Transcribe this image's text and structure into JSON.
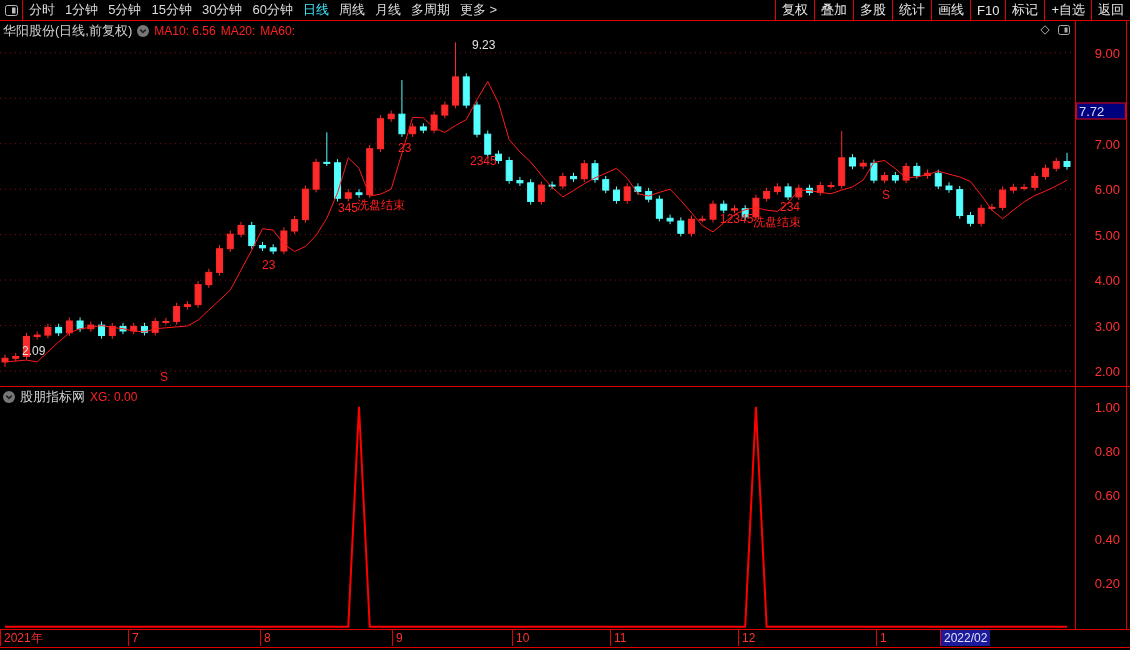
{
  "toolbar": {
    "periods": [
      {
        "label": "分时",
        "selected": false
      },
      {
        "label": "1分钟",
        "selected": false
      },
      {
        "label": "5分钟",
        "selected": false
      },
      {
        "label": "15分钟",
        "selected": false
      },
      {
        "label": "30分钟",
        "selected": false
      },
      {
        "label": "60分钟",
        "selected": false
      },
      {
        "label": "日线",
        "selected": true
      },
      {
        "label": "周线",
        "selected": false
      },
      {
        "label": "月线",
        "selected": false
      },
      {
        "label": "多周期",
        "selected": false
      },
      {
        "label": "更多 >",
        "selected": false
      }
    ],
    "buttons": [
      "复权",
      "叠加",
      "多股",
      "统计",
      "画线",
      "F10",
      "标记",
      "+自选",
      "返回"
    ]
  },
  "main_panel": {
    "title": "华阳股份(日线,前复权)",
    "indicators": [
      {
        "label": "MA10: 6.56"
      },
      {
        "label": "MA20:"
      },
      {
        "label": "MA60:"
      }
    ],
    "current_price": "7.72",
    "chart_data": {
      "type": "candlestick",
      "grid": true,
      "ylim": [
        1.67,
        9.7
      ],
      "yticks": [
        {
          "value": 9,
          "label": "9.00"
        },
        {
          "value": 7,
          "label": "7.00"
        },
        {
          "value": 6,
          "label": "6.00"
        },
        {
          "value": 5,
          "label": "5.00"
        },
        {
          "value": 4,
          "label": "4.00"
        },
        {
          "value": 3,
          "label": "3.00"
        },
        {
          "value": 2,
          "label": "2.00"
        }
      ],
      "categories": [
        null,
        null,
        null,
        null,
        null,
        null,
        null,
        null,
        null,
        null,
        null,
        null,
        null,
        null,
        null,
        null,
        null,
        null,
        null,
        null,
        null,
        null,
        null,
        null,
        null,
        null,
        null,
        null,
        null,
        null,
        null,
        null,
        null,
        null,
        null,
        null,
        null,
        null,
        null,
        null,
        null,
        null,
        null,
        null,
        null,
        null,
        null,
        null,
        null,
        null,
        null,
        null,
        null,
        null,
        null,
        null,
        null,
        null,
        null,
        null,
        null,
        null,
        null,
        null,
        null,
        null,
        null,
        null,
        null,
        null,
        null,
        null,
        null,
        null,
        null,
        null,
        null,
        null,
        null,
        null,
        null,
        null,
        null,
        null,
        null,
        null,
        null,
        null,
        null,
        null,
        null,
        null,
        null,
        null,
        null,
        null,
        null,
        null,
        null,
        null
      ],
      "ohlc": [
        [
          2.2,
          2.36,
          2.09,
          2.28
        ],
        [
          2.28,
          2.4,
          2.21,
          2.32
        ],
        [
          2.32,
          2.84,
          2.25,
          2.76
        ],
        [
          2.76,
          2.87,
          2.69,
          2.79
        ],
        [
          2.79,
          3.04,
          2.72,
          2.96
        ],
        [
          2.96,
          3.04,
          2.77,
          2.84
        ],
        [
          2.84,
          3.18,
          2.77,
          3.1
        ],
        [
          3.1,
          3.18,
          2.86,
          2.93
        ],
        [
          2.93,
          3.09,
          2.86,
          3.01
        ],
        [
          3.01,
          3.09,
          2.71,
          2.78
        ],
        [
          2.78,
          3.06,
          2.71,
          2.98
        ],
        [
          2.98,
          3.06,
          2.81,
          2.88
        ],
        [
          2.88,
          3.06,
          2.81,
          2.98
        ],
        [
          2.98,
          3.06,
          2.78,
          2.85
        ],
        [
          2.85,
          3.17,
          2.78,
          3.09
        ],
        [
          3.09,
          3.17,
          3.02,
          3.09
        ],
        [
          3.09,
          3.5,
          3.02,
          3.42
        ],
        [
          3.42,
          3.54,
          3.35,
          3.46
        ],
        [
          3.46,
          3.98,
          3.39,
          3.9
        ],
        [
          3.9,
          4.25,
          3.83,
          4.17
        ],
        [
          4.17,
          4.77,
          4.1,
          4.69
        ],
        [
          4.69,
          5.09,
          4.62,
          5.01
        ],
        [
          5.01,
          5.28,
          4.94,
          5.2
        ],
        [
          5.2,
          5.28,
          4.69,
          4.76
        ],
        [
          4.76,
          4.84,
          4.64,
          4.71
        ],
        [
          4.71,
          4.79,
          4.57,
          4.64
        ],
        [
          4.64,
          5.16,
          4.57,
          5.08
        ],
        [
          5.08,
          5.41,
          5.01,
          5.33
        ],
        [
          5.33,
          6.08,
          5.26,
          6.0
        ],
        [
          6.0,
          6.67,
          5.93,
          6.59
        ],
        [
          6.59,
          7.25,
          6.51,
          6.58
        ],
        [
          6.58,
          6.66,
          5.73,
          5.8
        ],
        [
          5.8,
          6.0,
          5.73,
          5.92
        ],
        [
          5.92,
          6.0,
          5.81,
          5.88
        ],
        [
          5.88,
          6.97,
          5.81,
          6.89
        ],
        [
          6.89,
          7.63,
          6.82,
          7.55
        ],
        [
          7.55,
          7.73,
          7.48,
          7.65
        ],
        [
          7.65,
          8.4,
          7.15,
          7.22
        ],
        [
          7.22,
          7.45,
          7.15,
          7.37
        ],
        [
          7.37,
          7.45,
          7.23,
          7.3
        ],
        [
          7.3,
          7.71,
          7.23,
          7.63
        ],
        [
          7.63,
          7.93,
          7.56,
          7.85
        ],
        [
          7.85,
          9.23,
          7.78,
          8.47
        ],
        [
          8.47,
          8.55,
          7.78,
          7.85
        ],
        [
          7.85,
          7.93,
          7.14,
          7.21
        ],
        [
          7.21,
          7.29,
          6.7,
          6.77
        ],
        [
          6.77,
          6.85,
          6.56,
          6.63
        ],
        [
          6.63,
          6.71,
          6.12,
          6.19
        ],
        [
          6.19,
          6.27,
          6.07,
          6.14
        ],
        [
          6.14,
          6.22,
          5.66,
          5.73
        ],
        [
          5.73,
          6.17,
          5.66,
          6.09
        ],
        [
          6.09,
          6.17,
          6.0,
          6.07
        ],
        [
          6.07,
          6.36,
          6.0,
          6.28
        ],
        [
          6.28,
          6.36,
          6.16,
          6.23
        ],
        [
          6.23,
          6.64,
          6.16,
          6.56
        ],
        [
          6.56,
          6.64,
          6.14,
          6.21
        ],
        [
          6.21,
          6.29,
          5.91,
          5.98
        ],
        [
          5.98,
          6.06,
          5.68,
          5.75
        ],
        [
          5.75,
          6.13,
          5.68,
          6.05
        ],
        [
          6.05,
          6.13,
          5.88,
          5.95
        ],
        [
          5.95,
          6.03,
          5.71,
          5.78
        ],
        [
          5.78,
          5.86,
          5.29,
          5.36
        ],
        [
          5.36,
          5.44,
          5.23,
          5.3
        ],
        [
          5.3,
          5.38,
          4.96,
          5.03
        ],
        [
          5.03,
          5.42,
          4.96,
          5.34
        ],
        [
          5.34,
          5.42,
          5.27,
          5.34
        ],
        [
          5.34,
          5.75,
          5.27,
          5.67
        ],
        [
          5.67,
          5.75,
          5.47,
          5.54
        ],
        [
          5.54,
          5.65,
          5.47,
          5.57
        ],
        [
          5.57,
          5.65,
          5.32,
          5.39
        ],
        [
          5.39,
          5.88,
          5.32,
          5.8
        ],
        [
          5.8,
          6.03,
          5.73,
          5.95
        ],
        [
          5.95,
          6.13,
          5.88,
          6.05
        ],
        [
          6.05,
          6.13,
          5.76,
          5.83
        ],
        [
          5.83,
          6.1,
          5.76,
          6.02
        ],
        [
          6.02,
          6.1,
          5.86,
          5.93
        ],
        [
          5.93,
          6.16,
          5.86,
          6.08
        ],
        [
          6.08,
          6.16,
          6.01,
          6.08
        ],
        [
          6.08,
          7.28,
          6.01,
          6.69
        ],
        [
          6.69,
          6.77,
          6.44,
          6.51
        ],
        [
          6.51,
          6.65,
          6.44,
          6.57
        ],
        [
          6.57,
          6.65,
          6.13,
          6.2
        ],
        [
          6.2,
          6.38,
          6.13,
          6.3
        ],
        [
          6.3,
          6.38,
          6.13,
          6.2
        ],
        [
          6.2,
          6.58,
          6.13,
          6.5
        ],
        [
          6.5,
          6.58,
          6.23,
          6.3
        ],
        [
          6.3,
          6.43,
          6.23,
          6.35
        ],
        [
          6.35,
          6.43,
          6.0,
          6.07
        ],
        [
          6.07,
          6.15,
          5.92,
          5.99
        ],
        [
          5.99,
          6.07,
          5.35,
          5.42
        ],
        [
          5.42,
          5.5,
          5.18,
          5.25
        ],
        [
          5.25,
          5.66,
          5.18,
          5.58
        ],
        [
          5.58,
          5.68,
          5.53,
          5.6
        ],
        [
          5.6,
          6.06,
          5.53,
          5.98
        ],
        [
          5.98,
          6.12,
          5.91,
          6.04
        ],
        [
          6.04,
          6.12,
          5.97,
          6.04
        ],
        [
          6.04,
          6.36,
          5.97,
          6.28
        ],
        [
          6.28,
          6.54,
          6.21,
          6.46
        ],
        [
          6.46,
          6.69,
          6.39,
          6.61
        ],
        [
          6.61,
          6.8,
          6.43,
          6.5
        ]
      ],
      "series": [
        {
          "type": "line",
          "color": "#ff1a1a",
          "values": [
            2.2,
            2.22,
            2.24,
            2.2,
            2.42,
            2.64,
            2.84,
            2.93,
            2.96,
            3.0,
            2.96,
            2.93,
            2.88,
            2.86,
            2.93,
            2.95,
            2.97,
            2.99,
            3.12,
            3.34,
            3.56,
            3.78,
            4.22,
            4.66,
            5.13,
            5.1,
            4.79,
            4.63,
            4.74,
            4.98,
            5.36,
            5.92,
            6.69,
            6.46,
            5.85,
            5.89,
            6.0,
            6.79,
            7.58,
            7.57,
            7.34,
            7.25,
            7.4,
            7.53,
            7.97,
            8.37,
            7.9,
            7.09,
            6.82,
            6.6,
            6.31,
            6.04,
            5.83,
            5.97,
            6.12,
            6.25,
            6.35,
            6.46,
            6.24,
            5.9,
            5.85,
            5.93,
            6.0,
            5.75,
            5.48,
            5.2,
            5.06,
            5.26,
            5.44,
            5.55,
            5.59,
            5.54,
            5.51,
            5.7,
            5.98,
            5.97,
            5.93,
            5.9,
            5.98,
            6.05,
            6.2,
            6.59,
            6.63,
            6.45,
            6.25,
            6.27,
            6.32,
            6.4,
            6.33,
            6.27,
            6.17,
            5.87,
            5.54,
            5.35,
            5.54,
            5.72,
            5.86,
            5.96,
            6.07,
            6.2
          ]
        }
      ]
    },
    "annotations": [
      {
        "text": "9.23"
      },
      {
        "text": "2.09"
      },
      {
        "text": "洗盘结束"
      },
      {
        "text": "洗盘结束"
      },
      {
        "text": "S"
      },
      {
        "text": "S"
      },
      {
        "text": "23"
      },
      {
        "text": "345"
      },
      {
        "text": "2345"
      },
      {
        "text": "23"
      },
      {
        "text": "12345"
      },
      {
        "text": "234"
      }
    ]
  },
  "indicator_panel": {
    "title": "股朋指标网",
    "reading": "XG: 0.00",
    "chart_data": {
      "type": "line",
      "ylim": [
        -0.01,
        1.09
      ],
      "categories": [
        null,
        null,
        null,
        null,
        null,
        null,
        null,
        null,
        null,
        null,
        null,
        null,
        null,
        null,
        null,
        null,
        null,
        null,
        null,
        null,
        null,
        null,
        null,
        null,
        null,
        null,
        null,
        null,
        null,
        null,
        null,
        null,
        null,
        null,
        null,
        null,
        null,
        null,
        null,
        null,
        null,
        null,
        null,
        null,
        null,
        null,
        null,
        null,
        null,
        null,
        null,
        null,
        null,
        null,
        null,
        null,
        null,
        null,
        null,
        null,
        null,
        null,
        null,
        null,
        null,
        null,
        null,
        null,
        null,
        null,
        null,
        null,
        null,
        null,
        null,
        null,
        null,
        null,
        null,
        null,
        null,
        null,
        null,
        null,
        null,
        null,
        null,
        null,
        null,
        null,
        null,
        null,
        null,
        null,
        null,
        null,
        null,
        null,
        null,
        null
      ],
      "yticks": [
        {
          "value": 1,
          "label": "1.00"
        },
        {
          "value": 0.8,
          "label": "0.80"
        },
        {
          "value": 0.6,
          "label": "0.60"
        },
        {
          "value": 0.4,
          "label": "0.40"
        },
        {
          "value": 0.2,
          "label": "0.20"
        }
      ],
      "series": [
        {
          "color": "#ff0000",
          "values": [
            0,
            0,
            0,
            0,
            0,
            0,
            0,
            0,
            0,
            0,
            0,
            0,
            0,
            0,
            0,
            0,
            0,
            0,
            0,
            0,
            0,
            0,
            0,
            0,
            0,
            0,
            0,
            0,
            0,
            0,
            0,
            0,
            0,
            1,
            0,
            0,
            0,
            0,
            0,
            0,
            0,
            0,
            0,
            0,
            0,
            0,
            0,
            0,
            0,
            0,
            0,
            0,
            0,
            0,
            0,
            0,
            0,
            0,
            0,
            0,
            0,
            0,
            0,
            0,
            0,
            0,
            0,
            0,
            0,
            0,
            1,
            0,
            0,
            0,
            0,
            0,
            0,
            0,
            0,
            0,
            0,
            0,
            0,
            0,
            0,
            0,
            0,
            0,
            0,
            0,
            0,
            0,
            0,
            0,
            0,
            0,
            0,
            0,
            0,
            0
          ]
        }
      ]
    }
  },
  "date_axis": [
    {
      "label": "2021年",
      "selected": false
    },
    {
      "label": "7",
      "selected": false
    },
    {
      "label": "8",
      "selected": false
    },
    {
      "label": "9",
      "selected": false
    },
    {
      "label": "10",
      "selected": false
    },
    {
      "label": "11",
      "selected": false
    },
    {
      "label": "12",
      "selected": false
    },
    {
      "label": "1",
      "selected": false
    },
    {
      "label": "2022/02",
      "selected": true
    }
  ]
}
